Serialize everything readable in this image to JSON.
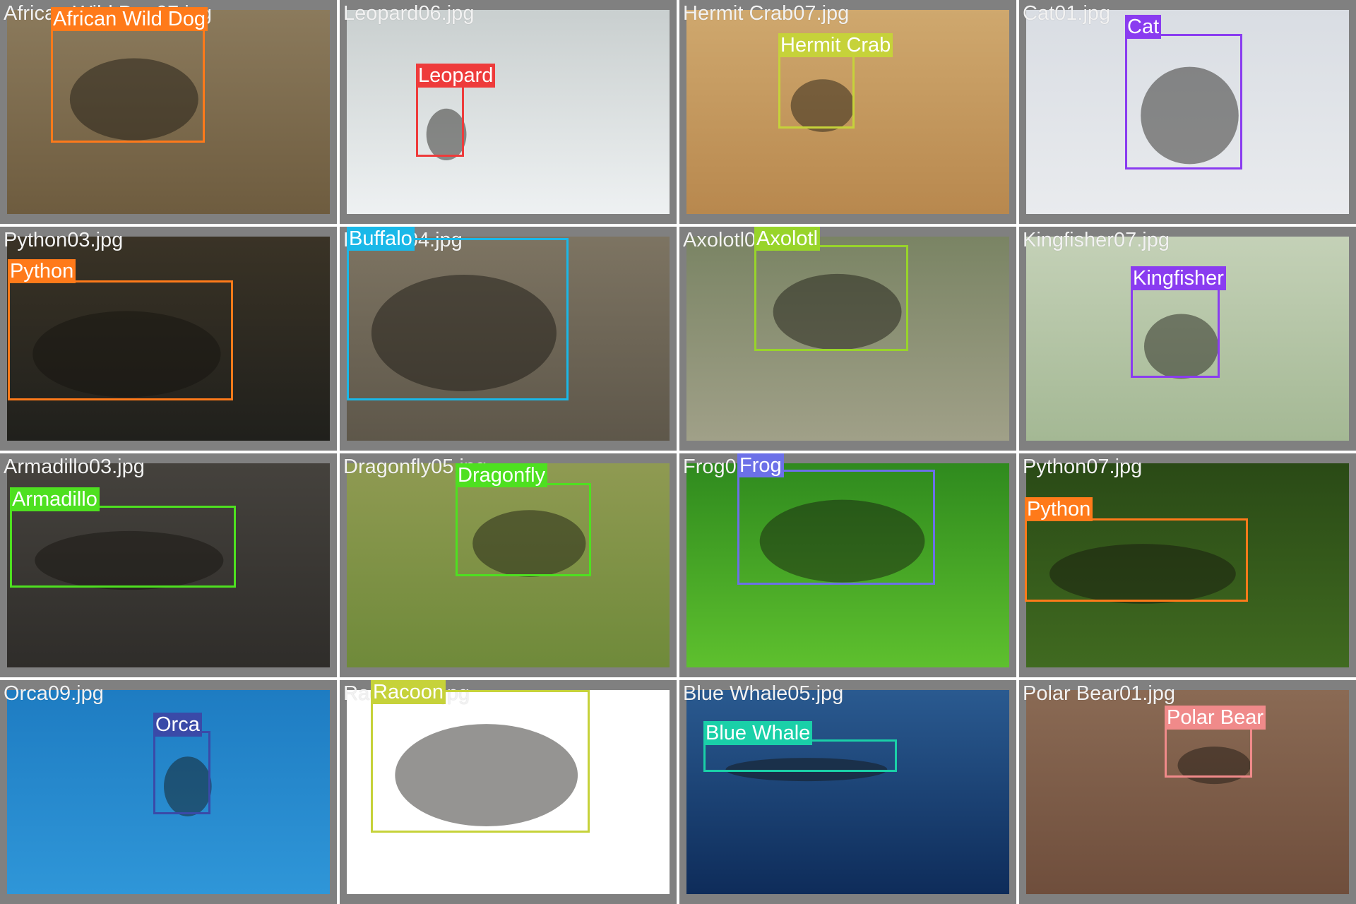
{
  "tiles": [
    {
      "filename": "African Wild Dog07.jpg",
      "label": "African Wild Dog",
      "color": "#ff7a1a",
      "icon": "wild-dog-photo",
      "bg": [
        "#8b7a5c",
        "#6e5c3f"
      ]
    },
    {
      "filename": "Leopard06.jpg",
      "label": "Leopard",
      "color": "#ee3b3b",
      "icon": "leopard-photo",
      "bg": [
        "#c9cfcf",
        "#eef1f2"
      ]
    },
    {
      "filename": "Hermit Crab07.jpg",
      "label": "Hermit Crab",
      "color": "#c6d23a",
      "icon": "hermit-crab-photo",
      "bg": [
        "#cfa86e",
        "#b8884e"
      ]
    },
    {
      "filename": "Cat01.jpg",
      "label": "Cat",
      "color": "#8a3cf0",
      "icon": "cat-photo",
      "bg": [
        "#d9dde3",
        "#e9ebee"
      ]
    },
    {
      "filename": "Python03.jpg",
      "label": "Python",
      "color": "#ff7a1a",
      "icon": "python-photo",
      "bg": [
        "#3a3326",
        "#20201c"
      ]
    },
    {
      "filename": "Buffalo04.jpg",
      "label": "Buffalo",
      "color": "#1ab8e8",
      "icon": "buffalo-photo",
      "bg": [
        "#7d7462",
        "#5e574a"
      ]
    },
    {
      "filename": "Axolotl04.jpg",
      "label": "Axolotl",
      "color": "#98d42a",
      "icon": "axolotl-photo",
      "bg": [
        "#7a8464",
        "#a0a088"
      ]
    },
    {
      "filename": "Kingfisher07.jpg",
      "label": "Kingfisher",
      "color": "#8a3cf0",
      "icon": "kingfisher-photo",
      "bg": [
        "#c4d1b7",
        "#a4b894"
      ]
    },
    {
      "filename": "Armadillo03.jpg",
      "label": "Armadillo",
      "color": "#4ee020",
      "icon": "armadillo-photo",
      "bg": [
        "#45423d",
        "#2f2d2a"
      ]
    },
    {
      "filename": "Dragonfly05.jpg",
      "label": "Dragonfly",
      "color": "#4ee020",
      "icon": "dragonfly-photo",
      "bg": [
        "#8f9a52",
        "#6f8a3a"
      ]
    },
    {
      "filename": "Frog07.jpg",
      "label": "Frog",
      "color": "#6c70e8",
      "icon": "frog-photo",
      "bg": [
        "#2f8a1e",
        "#5ec02e"
      ]
    },
    {
      "filename": "Python07.jpg",
      "label": "Python",
      "color": "#ff7a1a",
      "icon": "python-photo",
      "bg": [
        "#2a4a16",
        "#406a20"
      ]
    },
    {
      "filename": "Orca09.jpg",
      "label": "Orca",
      "color": "#3a4aa8",
      "icon": "orca-photo",
      "bg": [
        "#1e7cc2",
        "#2f96d8"
      ]
    },
    {
      "filename": "Racoon02.jpg",
      "label": "Racoon",
      "color": "#c6d23a",
      "icon": "racoon-photo",
      "bg": [
        "#ffffff",
        "#ffffff"
      ]
    },
    {
      "filename": "Blue Whale05.jpg",
      "label": "Blue Whale",
      "color": "#1ad0a8",
      "icon": "blue-whale-photo",
      "bg": [
        "#2a5a90",
        "#0e2c5a"
      ]
    },
    {
      "filename": "Polar Bear01.jpg",
      "label": "Polar Bear",
      "color": "#f08a8a",
      "icon": "polar-bear-photo",
      "bg": [
        "#8a6a54",
        "#6f4e3c"
      ]
    }
  ]
}
